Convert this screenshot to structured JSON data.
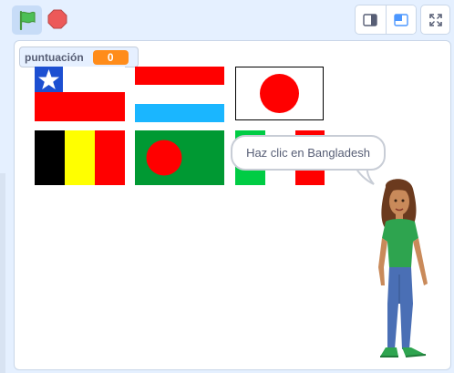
{
  "toolbar": {
    "green_flag_icon": "green-flag-icon",
    "stop_icon": "stop-icon",
    "layout_small_icon": "small-stage-icon",
    "layout_normal_icon": "normal-stage-icon",
    "fullscreen_icon": "fullscreen-icon"
  },
  "monitor": {
    "label": "puntuación",
    "value": "0"
  },
  "flags": [
    {
      "country": "chile"
    },
    {
      "country": "luxembourg"
    },
    {
      "country": "japan"
    },
    {
      "country": "belgium"
    },
    {
      "country": "bangladesh"
    },
    {
      "country": "italy"
    }
  ],
  "speech": {
    "text": "Haz clic en Bangladesh"
  },
  "colors": {
    "stage_bg": "#ffffff",
    "page_bg": "#e5f0ff",
    "monitor_accent": "#ff8c1a",
    "red": "#ff0000",
    "sky": "#1ab6ff",
    "green": "#009933",
    "yellow": "#ffff00"
  }
}
